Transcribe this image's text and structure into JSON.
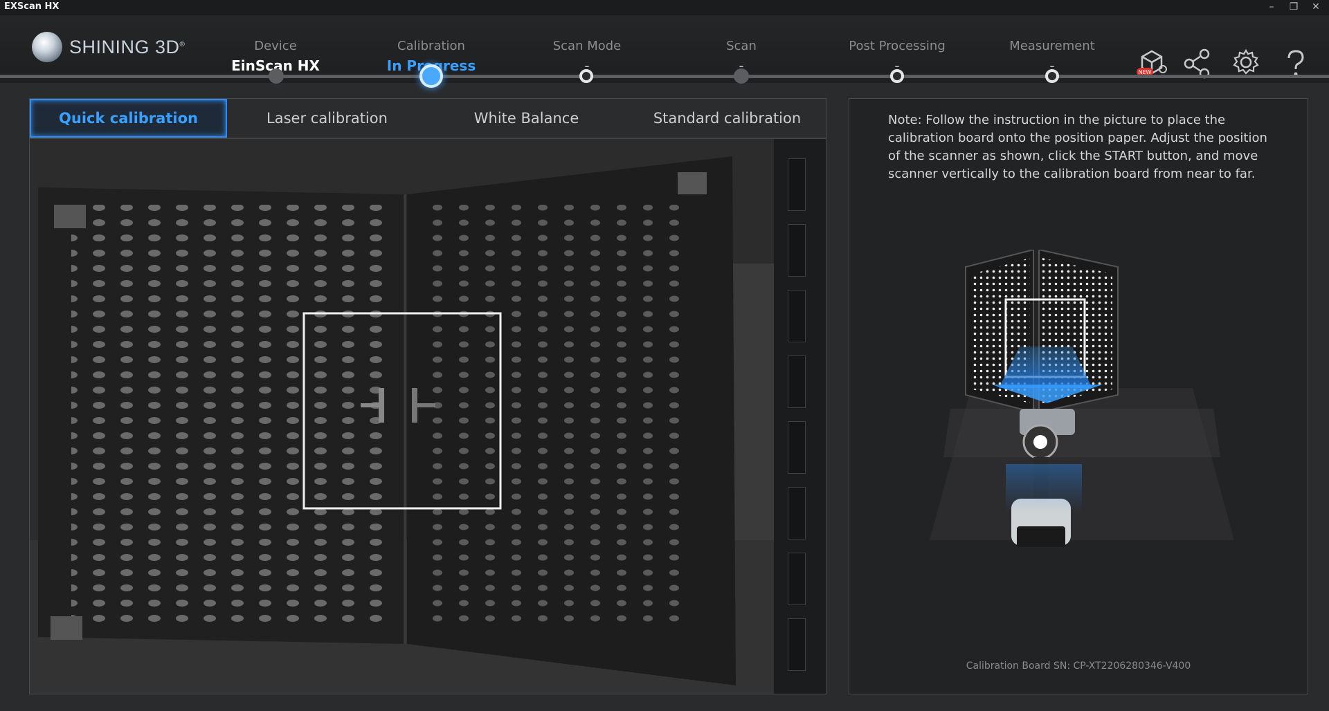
{
  "window": {
    "title": "EXScan HX",
    "controls": [
      "–",
      "❐",
      "✕"
    ]
  },
  "brand": {
    "name": "SHINING 3D",
    "mark": "®"
  },
  "steps": [
    {
      "label": "Device",
      "value": "EinScan HX",
      "state": "done"
    },
    {
      "label": "Calibration",
      "value": "In Progress",
      "state": "active"
    },
    {
      "label": "Scan Mode",
      "value": "-",
      "state": "pending"
    },
    {
      "label": "Scan",
      "value": "-",
      "state": "disabled"
    },
    {
      "label": "Post Processing",
      "value": "-",
      "state": "pending"
    },
    {
      "label": "Measurement",
      "value": "-",
      "state": "pending"
    }
  ],
  "header_icons": [
    {
      "name": "store-new-icon",
      "badge": "NEW"
    },
    {
      "name": "share-icon"
    },
    {
      "name": "settings-gear-icon"
    },
    {
      "name": "help-icon",
      "glyph": "?"
    }
  ],
  "tabs": [
    {
      "label": "Quick calibration",
      "active": true
    },
    {
      "label": "Laser calibration",
      "active": false
    },
    {
      "label": "White Balance",
      "active": false
    },
    {
      "label": "Standard calibration",
      "active": false
    }
  ],
  "instruction": {
    "note": "Note: Follow the instruction in the picture to place the calibration board onto the position paper. Adjust the position of the scanner as shown, click the START button, and move scanner vertically to the calibration board from near to far.",
    "serial": "Calibration Board SN: CP-XT2206280346-V400"
  },
  "colors": {
    "accent": "#3aa0ff",
    "background": "#2a2b2d"
  }
}
